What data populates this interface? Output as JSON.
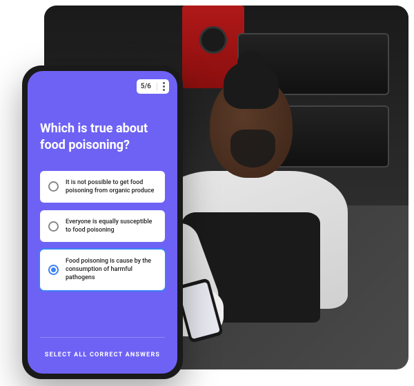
{
  "progress": {
    "counter": "5/6"
  },
  "quiz": {
    "question": "Which is true about food poisoning?",
    "answers": [
      {
        "label": "It is not possible to get food poisoning from organic produce",
        "selected": false
      },
      {
        "label": "Everyone is equally susceptible to food poisoning",
        "selected": false
      },
      {
        "label": "Food poisoning is cause by the consumption of harmful pathogens",
        "selected": true
      }
    ],
    "hint": "SELECT ALL CORRECT ANSWERS"
  },
  "colors": {
    "accent": "#6e62f5",
    "selection": "#3b82f6"
  }
}
